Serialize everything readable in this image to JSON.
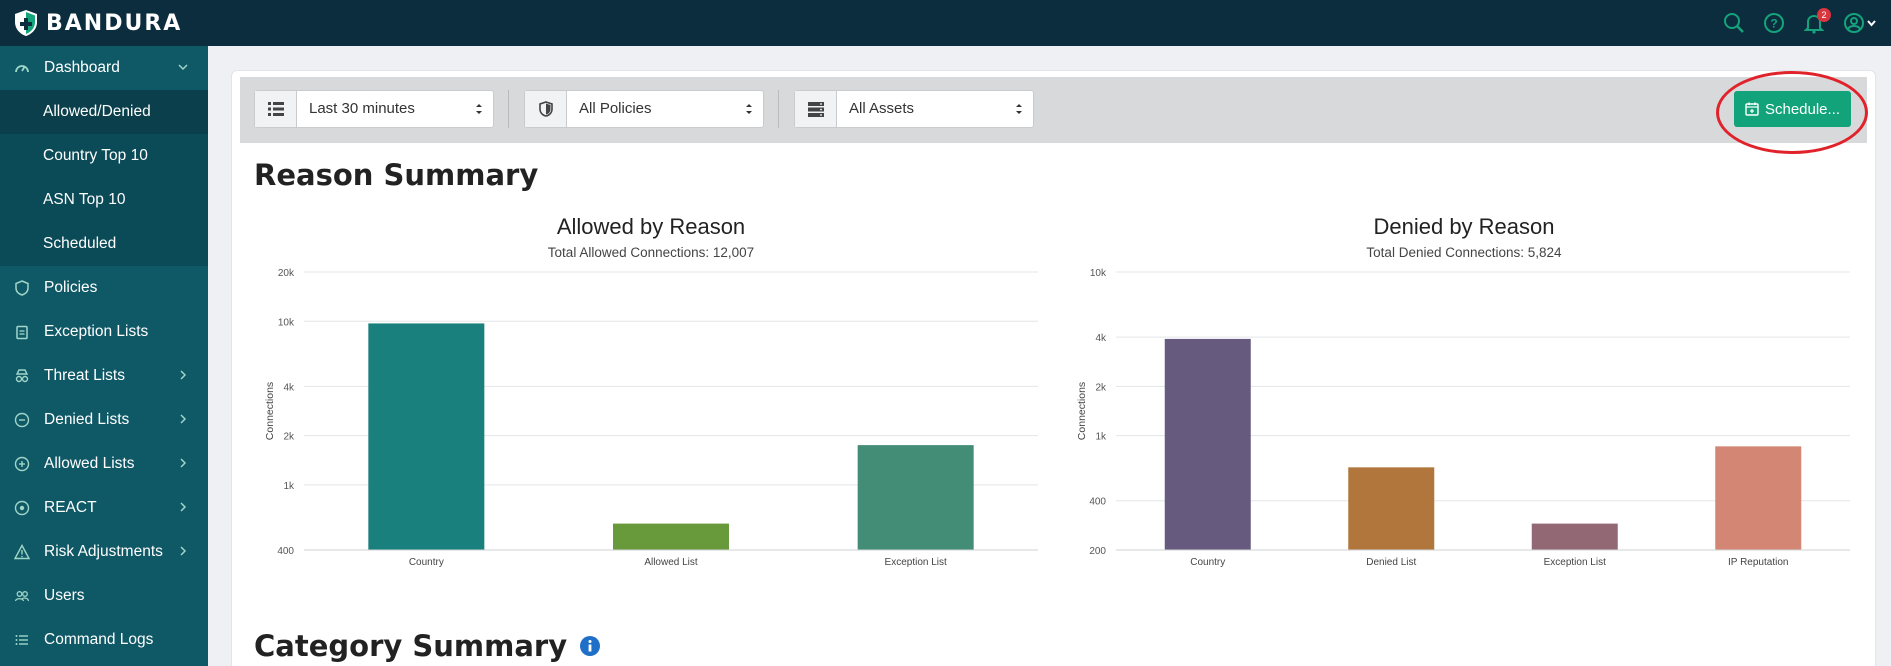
{
  "brand": {
    "name": "BANDURA"
  },
  "topbar": {
    "icons": [
      "search-icon",
      "help-icon",
      "bell-icon",
      "user-icon"
    ],
    "notification_count": "2"
  },
  "sidebar": {
    "items": [
      {
        "label": "Dashboard",
        "icon": "dashboard-icon"
      },
      {
        "label": "Allowed/Denied"
      },
      {
        "label": "Country Top 10"
      },
      {
        "label": "ASN Top 10"
      },
      {
        "label": "Scheduled"
      },
      {
        "label": "Policies",
        "icon": "shield-icon"
      },
      {
        "label": "Exception Lists",
        "icon": "clipboard-icon"
      },
      {
        "label": "Threat Lists",
        "icon": "spy-icon"
      },
      {
        "label": "Denied Lists",
        "icon": "minus-circle-icon"
      },
      {
        "label": "Allowed Lists",
        "icon": "plus-circle-icon"
      },
      {
        "label": "REACT",
        "icon": "react-icon"
      },
      {
        "label": "Risk Adjustments",
        "icon": "warning-icon"
      },
      {
        "label": "Users",
        "icon": "users-icon"
      },
      {
        "label": "Command Logs",
        "icon": "list-icon"
      }
    ]
  },
  "filters": {
    "time": "Last 30 minutes",
    "policy": "All Policies",
    "assets": "All Assets",
    "schedule_label": "Schedule..."
  },
  "sections": {
    "reason_summary": "Reason Summary",
    "category_summary": "Category Summary"
  },
  "colors": {
    "accent": "#12a37a",
    "sidebar": "#0f5866",
    "topbar": "#0c2d3e",
    "highlight": "#e0232b"
  },
  "chart_data": [
    {
      "type": "bar",
      "title": "Allowed by Reason",
      "subtitle": "Total Allowed Connections: 12,007",
      "ylabel": "Connections",
      "yscale": "log",
      "yticks": [
        400,
        1000,
        2000,
        4000,
        10000,
        20000
      ],
      "ytick_labels": [
        "400",
        "1k",
        "2k",
        "4k",
        "10k",
        "20k"
      ],
      "categories": [
        "Country",
        "Allowed List",
        "Exception List"
      ],
      "values": [
        9700,
        580,
        1750
      ],
      "colors": [
        "#1a807d",
        "#689a3c",
        "#438c76"
      ]
    },
    {
      "type": "bar",
      "title": "Denied by Reason",
      "subtitle": "Total Denied Connections: 5,824",
      "ylabel": "Connections",
      "yscale": "log",
      "yticks": [
        200,
        400,
        1000,
        2000,
        4000,
        10000
      ],
      "ytick_labels": [
        "200",
        "400",
        "1k",
        "2k",
        "4k",
        "10k"
      ],
      "categories": [
        "Country",
        "Denied List",
        "Exception List",
        "IP Reputation"
      ],
      "values": [
        3900,
        640,
        290,
        860
      ],
      "colors": [
        "#665a7e",
        "#b0763c",
        "#936875",
        "#d38674"
      ]
    }
  ]
}
